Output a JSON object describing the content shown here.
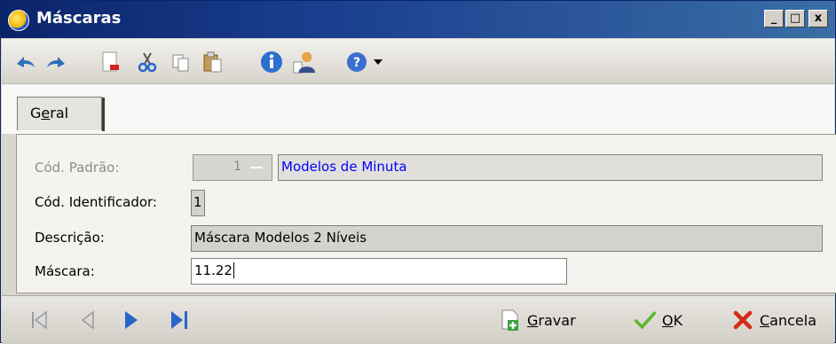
{
  "window": {
    "title": "Máscaras",
    "minimize": "_",
    "maximize": "□",
    "close": "x"
  },
  "toolbar": {
    "icons": [
      "undo-icon",
      "redo-icon",
      "delete-icon",
      "cut-icon",
      "copy-icon",
      "paste-icon",
      "info-icon",
      "user-icon",
      "help-icon",
      "dropdown-icon"
    ]
  },
  "tabs": [
    {
      "label_pre": "G",
      "label_ul": "e",
      "label_post": "ral"
    }
  ],
  "form": {
    "cod_padrao": {
      "label": "Cód. Padrão:",
      "value": "1",
      "description": "Modelos de Minuta"
    },
    "cod_identificador": {
      "label": "Cód. Identificador:",
      "value": "1"
    },
    "descricao": {
      "label": "Descrição:",
      "value": "Máscara Modelos 2 Níveis"
    },
    "mascara": {
      "label": "Máscara:",
      "value": "11.22"
    }
  },
  "footer": {
    "gravar": {
      "ul": "G",
      "rest": "ravar"
    },
    "ok": {
      "ul": "O",
      "rest": "K"
    },
    "cancela": {
      "ul": "C",
      "rest": "ancela"
    }
  },
  "colors": {
    "accent": "#0000ff",
    "title_bar": "#0a246a"
  }
}
